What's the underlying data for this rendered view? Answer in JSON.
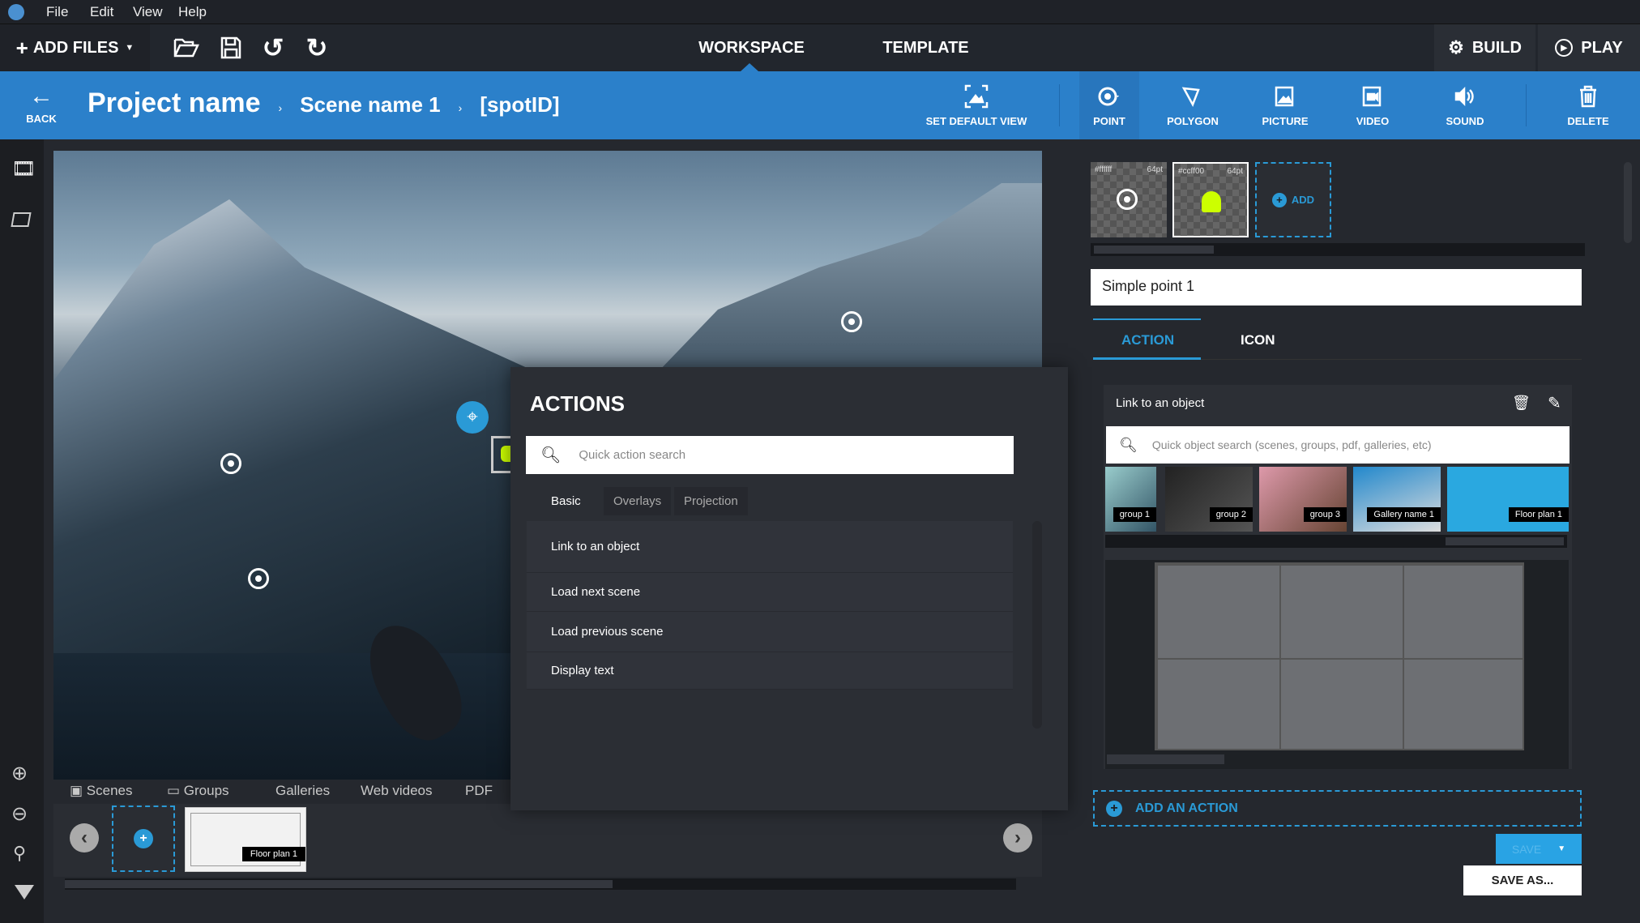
{
  "menu": {
    "items": [
      "File",
      "Edit",
      "View",
      "Help"
    ]
  },
  "toolbar": {
    "add_files": "ADD FILES",
    "tabs": [
      "WORKSPACE",
      "TEMPLATE"
    ],
    "build": "BUILD",
    "play": "PLAY"
  },
  "breadcrumb": {
    "back": "BACK",
    "project": "Project name",
    "scene": "Scene name 1",
    "spot": "[spotID]"
  },
  "tools": {
    "set_default_view": "SET DEFAULT VIEW",
    "point": "POINT",
    "polygon": "POLYGON",
    "picture": "PICTURE",
    "video": "VIDEO",
    "sound": "SOUND",
    "delete": "DELETE"
  },
  "bottom_tabs": [
    "Scenes",
    "Groups",
    "Galleries",
    "Web videos",
    "PDF"
  ],
  "filmstrip": {
    "items": [
      "Floor plan 1"
    ]
  },
  "actions": {
    "title": "ACTIONS",
    "search_placeholder": "Quick action search",
    "tabs": [
      "Basic",
      "Overlays",
      "Projection"
    ],
    "items": [
      "Link to an object",
      "Load next scene",
      "Load previous scene",
      "Display text"
    ]
  },
  "icons_panel": {
    "items": [
      {
        "color": "#ffffff",
        "size": "64pt"
      },
      {
        "color": "#ccff00",
        "size": "64pt"
      }
    ],
    "add": "ADD"
  },
  "name_field": {
    "value": "Simple point 1"
  },
  "prop_tabs": {
    "action": "ACTION",
    "icon": "ICON"
  },
  "action_card": {
    "title": "Link to an object",
    "search_placeholder": "Quick object search (scenes, groups, pdf, galleries, etc)",
    "objects": [
      "group 1",
      "group 2",
      "group 3",
      "Gallery name 1",
      "Floor plan 1"
    ]
  },
  "add_action": "ADD AN ACTION",
  "save": "SAVE",
  "save_as": "SAVE AS...",
  "colors": {
    "accent": "#2a9ad6",
    "toolbar_blue": "#2b80ca",
    "android_green": "#ccff00"
  }
}
